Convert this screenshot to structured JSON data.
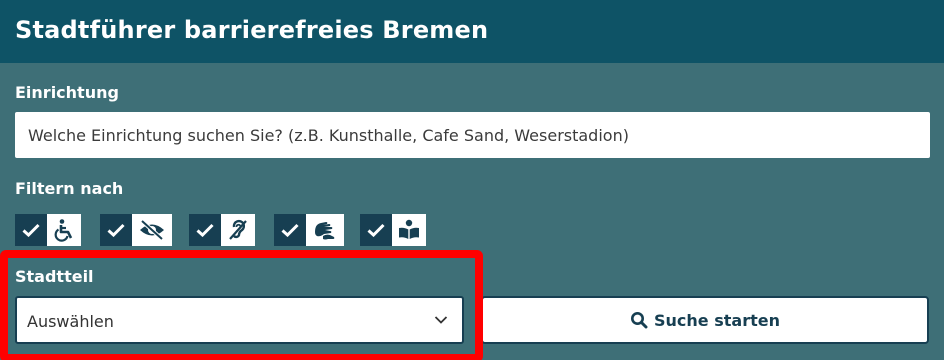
{
  "header": {
    "title": "Stadtführer barrierefreies Bremen"
  },
  "einrichtung": {
    "label": "Einrichtung",
    "placeholder": "Welche Einrichtung suchen Sie? (z.B. Kunsthalle, Cafe Sand, Weserstadion)"
  },
  "filters": {
    "label": "Filtern nach",
    "items": [
      {
        "icon": "wheelchair-icon",
        "checked": true
      },
      {
        "icon": "eye-slash-icon",
        "checked": true
      },
      {
        "icon": "hearing-impaired-icon",
        "checked": true
      },
      {
        "icon": "sign-language-icon",
        "checked": true
      },
      {
        "icon": "easy-reading-book-icon",
        "checked": true
      }
    ]
  },
  "stadtteil": {
    "label": "Stadtteil",
    "selected": "Auswählen"
  },
  "search_button": {
    "label": "Suche starten"
  },
  "colors": {
    "background": "#3e6f77",
    "header": "#0e5366",
    "accent": "#173f52",
    "highlight": "#ff0000"
  }
}
